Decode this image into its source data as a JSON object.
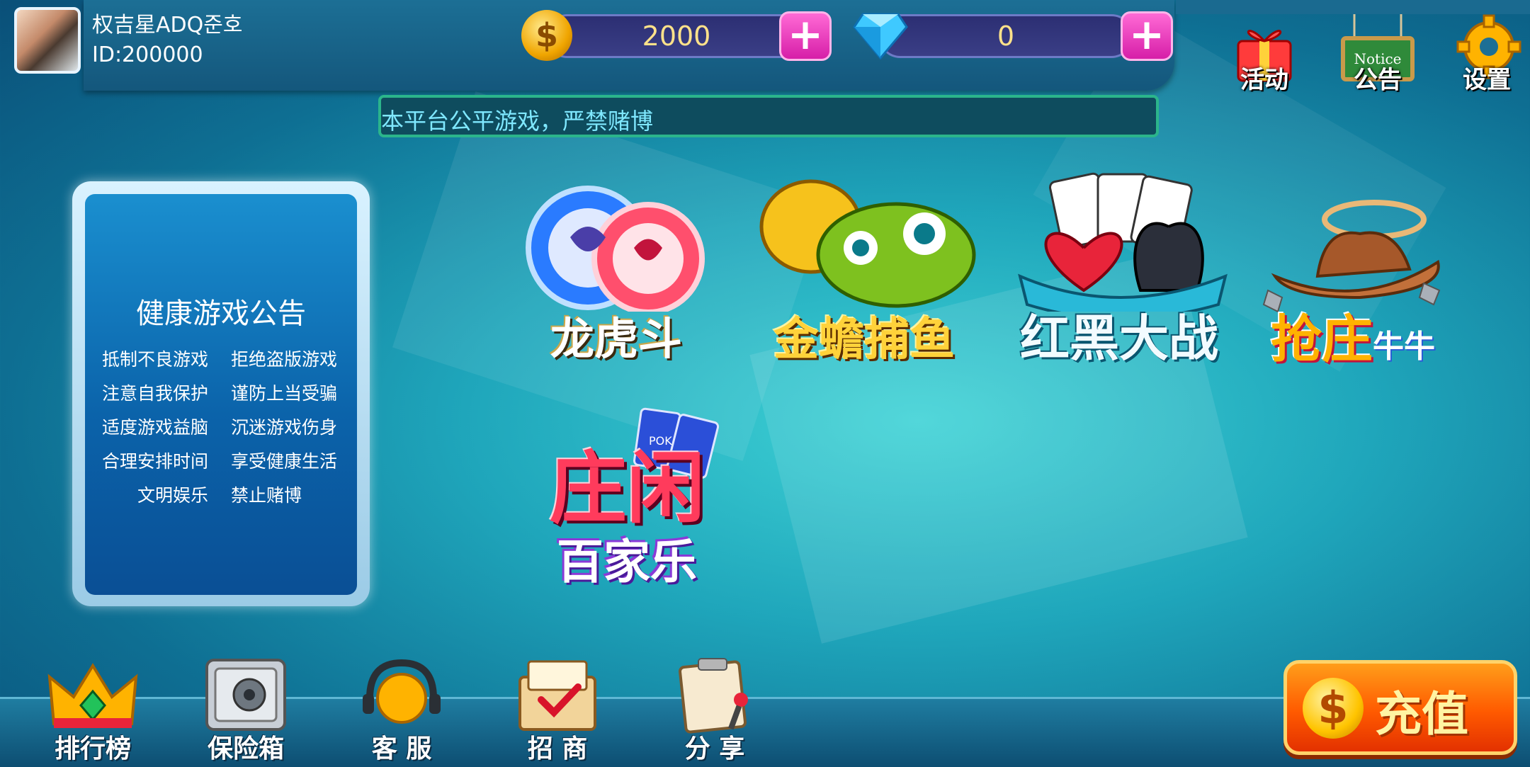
{
  "user": {
    "name": "权吉星ADQ준호",
    "id": "ID:200000"
  },
  "currency": {
    "gold": "2000",
    "diamonds": "0"
  },
  "top_buttons": {
    "activity": "活动",
    "notice": "公告",
    "notice_board_text": "Notice",
    "settings": "设置"
  },
  "marquee": {
    "text": "本平台公平游戏，严禁赌博"
  },
  "notice_board": {
    "title": "健康游戏公告",
    "rows": [
      [
        "抵制不良游戏",
        "拒绝盗版游戏"
      ],
      [
        "注意自我保护",
        "谨防上当受骗"
      ],
      [
        "适度游戏益脑",
        "沉迷游戏伤身"
      ],
      [
        "合理安排时间",
        "享受健康生活"
      ],
      [
        "文明娱乐",
        "禁止赌博"
      ]
    ]
  },
  "games": {
    "dragon_tiger": "龙虎斗",
    "golden_toad": "金蟾捕鱼",
    "red_black": "红黑大战",
    "grab_banker": "抢庄",
    "grab_banker_sub": "牛牛",
    "baccarat_top": "庄闲",
    "baccarat_bottom": "百家乐",
    "baccarat_card": "POK"
  },
  "bottom_menu": {
    "ranking": "排行榜",
    "safe": "保险箱",
    "service": "客 服",
    "merchant": "招 商",
    "share": "分 享"
  },
  "recharge": {
    "label": "充值",
    "icon": "$"
  },
  "icons": {
    "coin": "$",
    "plus": "+"
  },
  "colors": {
    "gold_text": "#ffe28a",
    "plus_button": "#e93ac0",
    "recharge": "#ff5a00",
    "board": "#0b63aa"
  }
}
